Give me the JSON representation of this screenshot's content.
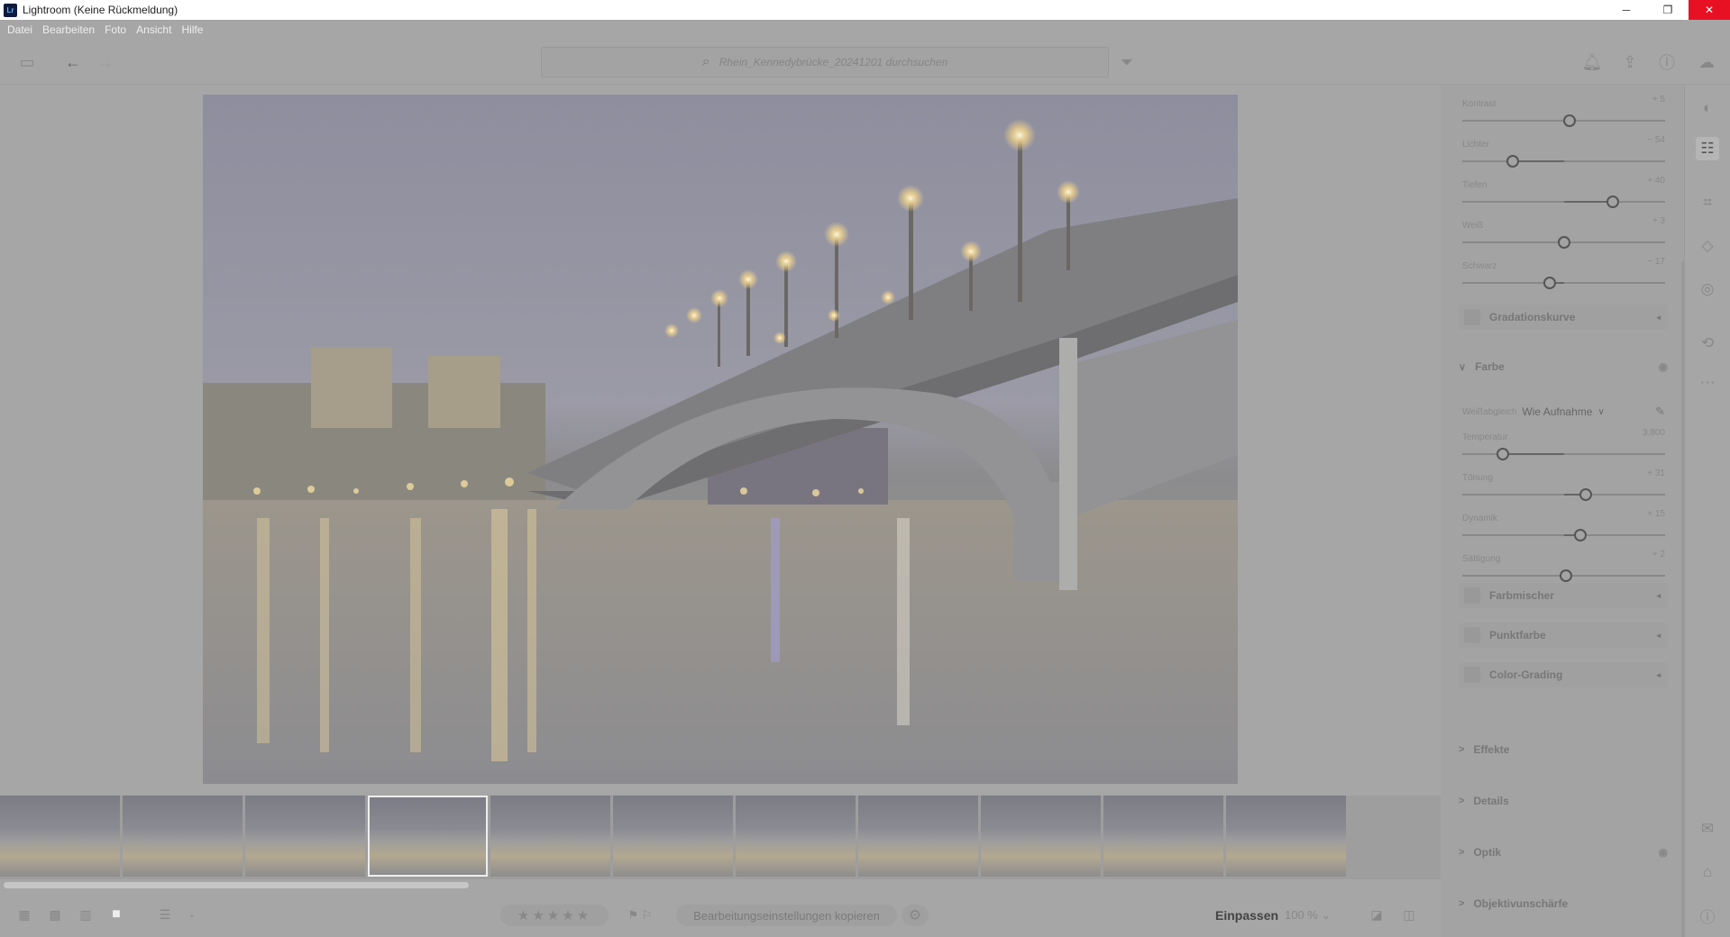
{
  "window": {
    "title": "Lightroom (Keine Rückmeldung)",
    "minimize": "─",
    "restore": "❐",
    "close": "✕",
    "logo": "Lr"
  },
  "menu": [
    "Datei",
    "Bearbeiten",
    "Foto",
    "Ansicht",
    "Hilfe"
  ],
  "toolbar": {
    "search_placeholder": "Rhein_Kennedybrücke_20241201 durchsuchen"
  },
  "panel": {
    "sliders": [
      {
        "label": "Kontrast",
        "value": "+ 5",
        "pos": 0.53
      },
      {
        "label": "Lichter",
        "value": "− 54",
        "pos": 0.25
      },
      {
        "label": "Tiefen",
        "value": "+ 40",
        "pos": 0.74
      },
      {
        "label": "Weiß",
        "value": "+ 3",
        "pos": 0.5
      },
      {
        "label": "Schwarz",
        "value": "− 17",
        "pos": 0.43
      }
    ],
    "gradation": "Gradationskurve",
    "color_section": "Farbe",
    "wb_label": "Weißabgleich",
    "wb_value": "Wie Aufnahme",
    "color_sliders": [
      {
        "label": "Temperatur",
        "value": "3.800",
        "pos": 0.2
      },
      {
        "label": "Tönung",
        "value": "+ 31",
        "pos": 0.61
      },
      {
        "label": "Dynamik",
        "value": "+ 15",
        "pos": 0.58
      },
      {
        "label": "Sättigung",
        "value": "+ 2",
        "pos": 0.51
      }
    ],
    "subpanels": [
      "Farbmischer",
      "Punktfarbe",
      "Color-Grading"
    ],
    "sections": [
      "Effekte",
      "Details",
      "Optik",
      "Objektivunschärfe"
    ]
  },
  "bottom": {
    "copy_label": "Bearbeitungseinstellungen kopieren",
    "fit": "Einpassen",
    "zoom": "100 %",
    "stars": "★★★★★",
    "flags": "⚑ ⚐"
  },
  "filmstrip": {
    "count": 11,
    "selected_index": 3
  }
}
